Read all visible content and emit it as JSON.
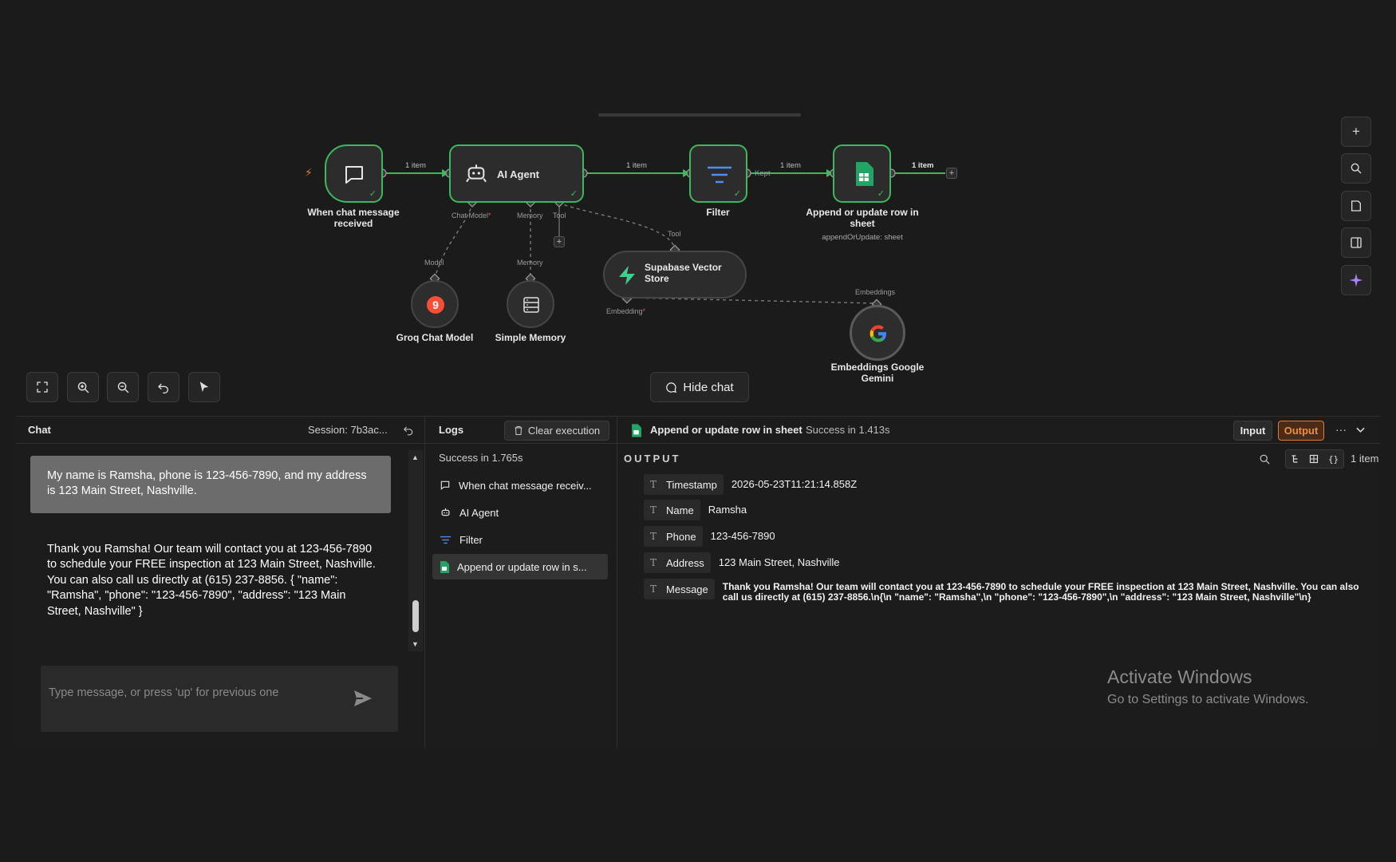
{
  "canvas": {
    "nodes": {
      "trigger": {
        "label": "When chat message received"
      },
      "agent": {
        "label": "AI Agent"
      },
      "filter": {
        "label": "Filter"
      },
      "sheet": {
        "label": "Append or update row in sheet",
        "sublabel": "appendOrUpdate: sheet"
      },
      "groq": {
        "label": "Groq Chat Model"
      },
      "memory": {
        "label": "Simple Memory"
      },
      "supabase": {
        "label": "Supabase Vector Store"
      },
      "embeddings": {
        "label": "Embeddings Google Gemini"
      }
    },
    "edge_labels": {
      "trigger_agent": "1 item",
      "agent_filter": "1 item",
      "filter_sheet": "1 item",
      "sheet_out": "1 item",
      "kept": "Kept"
    },
    "port_labels": {
      "chat_model": "Chat Model",
      "memory_top": "Memory",
      "tool_top": "Tool",
      "model": "Model",
      "memory_bottom": "Memory",
      "tool_in": "Tool",
      "embedding": "Embedding",
      "embeddings": "Embeddings"
    },
    "hide_chat_label": "Hide chat"
  },
  "chat": {
    "title": "Chat",
    "session": "Session: 7b3ac...",
    "user_message": "My name is Ramsha, phone is 123-456-7890, and my address is 123 Main Street, Nashville.",
    "bot_message": "Thank you Ramsha! Our team will contact you at 123-456-7890 to schedule your FREE inspection at 123 Main Street, Nashville. You can also call us directly at (615) 237-8856. { \"name\": \"Ramsha\", \"phone\": \"123-456-7890\", \"address\": \"123 Main Street, Nashville\" }",
    "input_placeholder": "Type message, or press 'up' for previous one"
  },
  "logs": {
    "title": "Logs",
    "clear_label": "Clear execution",
    "status": "Success in 1.765s",
    "items": [
      {
        "label": "When chat message receiv...",
        "icon": "chat-icon"
      },
      {
        "label": "AI Agent",
        "icon": "robot-icon"
      },
      {
        "label": "Filter",
        "icon": "filter-icon"
      },
      {
        "label": "Append or update row in s...",
        "icon": "sheets-icon"
      }
    ]
  },
  "output": {
    "node_title": "Append or update row in sheet",
    "status": "Success in 1.413s",
    "input_label": "Input",
    "output_label": "Output",
    "section": "OUTPUT",
    "item_count": "1 item",
    "fields": [
      {
        "key": "Timestamp",
        "value": "2026-05-23T11:21:14.858Z"
      },
      {
        "key": "Name",
        "value": "Ramsha"
      },
      {
        "key": "Phone",
        "value": "123-456-7890"
      },
      {
        "key": "Address",
        "value": "123 Main Street, Nashville"
      },
      {
        "key": "Message",
        "value": "Thank you Ramsha! Our team will contact you at 123-456-7890 to schedule your FREE inspection at 123 Main Street, Nashville. You can also call us directly at (615) 237-8856.\\n{\\n \"name\": \"Ramsha\",\\n \"phone\": \"123-456-7890\",\\n \"address\": \"123 Main Street, Nashville\"\\n}"
      }
    ]
  },
  "watermark": {
    "title": "Activate Windows",
    "subtitle": "Go to Settings to activate Windows."
  },
  "colors": {
    "accent_green": "#3eb85c",
    "output_orange": "#e8792d",
    "bg": "#1b1b1b"
  }
}
